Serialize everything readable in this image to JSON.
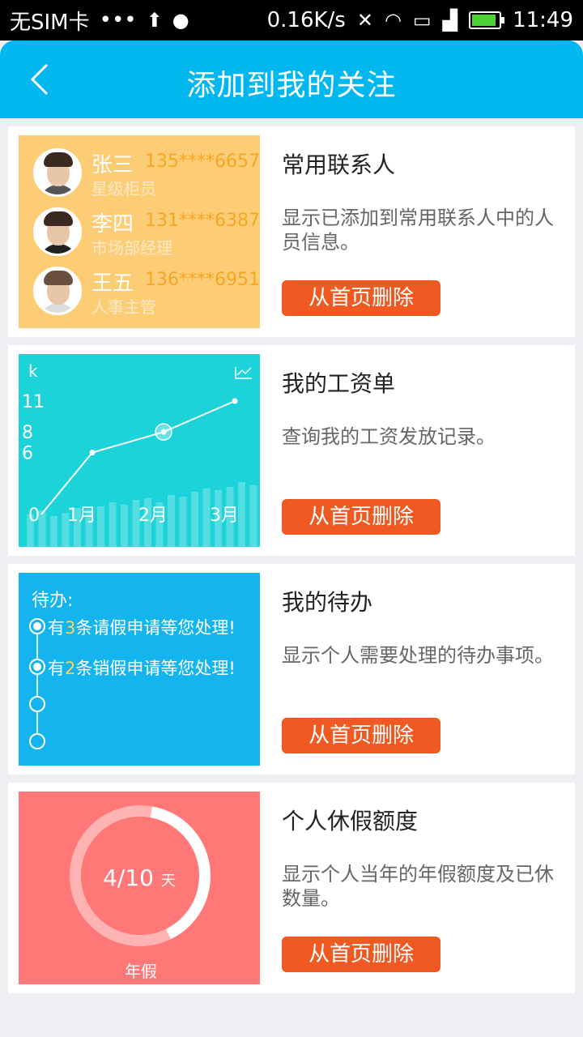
{
  "status_bar": {
    "carrier": "无SIM卡",
    "dots": "•••",
    "net_speed": "0.16K/s",
    "time": "11:49",
    "icons": [
      "upload-arrow-icon",
      "android-icon",
      "mute-icon",
      "wifi-icon",
      "sim-icon",
      "signal-icon",
      "battery-icon"
    ]
  },
  "header": {
    "title": "添加到我的关注",
    "back_icon": "chevron-left-icon",
    "color": "#00b8ef"
  },
  "cards": [
    {
      "title": "常用联系人",
      "desc": "显示已添加到常用联系人中的人员信息。",
      "button": "从首页删除",
      "contacts": [
        {
          "name": "张三",
          "phone": "135****6657",
          "role": "星级柜员"
        },
        {
          "name": "李四",
          "phone": "131****6387",
          "role": "市场部经理"
        },
        {
          "name": "王五",
          "phone": "136****6951",
          "role": "人事主管"
        }
      ]
    },
    {
      "title": "我的工资单",
      "desc": "查询我的工资发放记录。",
      "button": "从首页删除",
      "chart_data": {
        "type": "line",
        "ylabel": "k",
        "y_ticks": [
          "11",
          "8",
          "6",
          "0"
        ],
        "categories": [
          "1月",
          "2月",
          "3月"
        ],
        "x_tick_labels": [
          "0",
          "1月",
          "2月",
          "3月"
        ],
        "values": [
          0,
          6,
          8,
          11
        ],
        "icon": "line-chart-icon"
      }
    },
    {
      "title": "我的待办",
      "desc": "显示个人需要处理的待办事项。",
      "button": "从首页删除",
      "todo": {
        "label": "待办:",
        "items": [
          {
            "prefix": "有",
            "num": "3",
            "suffix": "条请假申请等您处理!"
          },
          {
            "prefix": "有",
            "num": "2",
            "suffix": "条销假申请等您处理!"
          }
        ]
      }
    },
    {
      "title": "个人休假额度",
      "desc": "显示个人当年的年假额度及已休数量。",
      "button": "从首页删除",
      "leave": {
        "used": "4",
        "total": "/10",
        "unit": "天",
        "label": "年假",
        "fraction": 0.4
      }
    }
  ],
  "colors": {
    "button": "#f05a22",
    "contacts_bg": "#fdcd75",
    "salary_bg": "#1bd3d8",
    "todo_bg": "#14b4ef",
    "leave_bg": "#ff7777"
  }
}
